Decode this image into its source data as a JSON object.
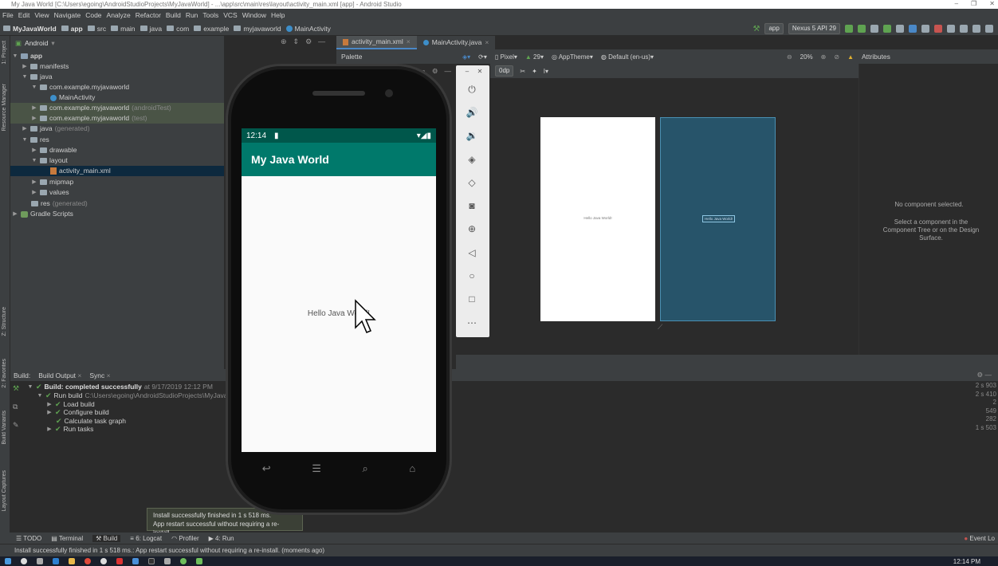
{
  "window": {
    "title": "My Java World [C:\\Users\\egoing\\AndroidStudioProjects\\MyJavaWorld] - ...\\app\\src\\main\\res\\layout\\activity_main.xml [app] - Android Studio"
  },
  "menu": [
    "File",
    "Edit",
    "View",
    "Navigate",
    "Code",
    "Analyze",
    "Refactor",
    "Build",
    "Run",
    "Tools",
    "VCS",
    "Window",
    "Help"
  ],
  "breadcrumbs": [
    "MyJavaWorld",
    "app",
    "src",
    "main",
    "java",
    "com",
    "example",
    "myjavaworld",
    "MainActivity"
  ],
  "toolbar": {
    "run_config": "app",
    "device": "Nexus 5 API 29"
  },
  "project": {
    "view_mode": "Android",
    "side_tabs": [
      "1: Project",
      "Resource Manager",
      "Z: Structure",
      "2: Favorites",
      "Build Variants",
      "Layout Captures"
    ],
    "tree": [
      {
        "label": "app",
        "suffix": ""
      },
      {
        "label": "manifests",
        "suffix": ""
      },
      {
        "label": "java",
        "suffix": ""
      },
      {
        "label": "com.example.myjavaworld",
        "suffix": ""
      },
      {
        "label": "MainActivity",
        "suffix": ""
      },
      {
        "label": "com.example.myjavaworld",
        "suffix": "(androidTest)"
      },
      {
        "label": "com.example.myjavaworld",
        "suffix": "(test)"
      },
      {
        "label": "java",
        "suffix": "(generated)"
      },
      {
        "label": "res",
        "suffix": ""
      },
      {
        "label": "drawable",
        "suffix": ""
      },
      {
        "label": "layout",
        "suffix": ""
      },
      {
        "label": "activity_main.xml",
        "suffix": ""
      },
      {
        "label": "mipmap",
        "suffix": ""
      },
      {
        "label": "values",
        "suffix": ""
      },
      {
        "label": "res",
        "suffix": "(generated)"
      },
      {
        "label": "Gradle Scripts",
        "suffix": ""
      }
    ]
  },
  "editor": {
    "tabs": [
      "activity_main.xml",
      "MainActivity.java"
    ],
    "palette_label": "Palette",
    "design_toolbar": {
      "device": "Pixel",
      "api": "29",
      "theme": "AppTheme",
      "locale": "Default (en-us)",
      "zoom": "20%",
      "margin": "0dp"
    },
    "design_preview_text": "Hello Java World!",
    "blueprint_text": "Hello Java World!"
  },
  "attributes": {
    "header": "Attributes",
    "empty_title": "No component selected.",
    "empty_hint": "Select a component in the Component Tree or on the Design Surface."
  },
  "emulator": {
    "time": "12:14",
    "app_title": "My Java World",
    "content_text": "Hello Java World!"
  },
  "build": {
    "tabs": [
      "Build:",
      "Build Output",
      "Sync"
    ],
    "rows": [
      {
        "label": "Build: completed successfully",
        "detail": "at 9/17/2019 12:12 PM",
        "time": "2 s 903"
      },
      {
        "label": "Run build",
        "detail": "C:\\Users\\egoing\\AndroidStudioProjects\\MyJavaW",
        "time": "2 s 410"
      },
      {
        "label": "Load build",
        "detail": "",
        "time": "2"
      },
      {
        "label": "Configure build",
        "detail": "",
        "time": "549"
      },
      {
        "label": "Calculate task graph",
        "detail": "",
        "time": "282"
      },
      {
        "label": "Run tasks",
        "detail": "",
        "time": "1 s 503"
      }
    ]
  },
  "toast": {
    "line1": "Install successfully finished in 1 s 518 ms.",
    "line2": "App restart successful without requiring a re-install."
  },
  "bottom_tabs": [
    "TODO",
    "Terminal",
    "Build",
    "6: Logcat",
    "Profiler",
    "4: Run"
  ],
  "event_log": "Event Lo",
  "status": "Install successfully finished in 1 s 518 ms.: App restart successful without requiring a re-install. (moments ago)",
  "taskbar": {
    "clock": "12:14 PM"
  }
}
